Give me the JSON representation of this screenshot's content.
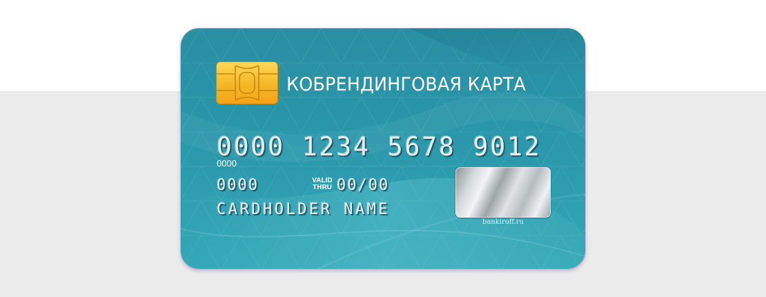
{
  "card": {
    "brand_title": "КОБРЕНДИНГОВАЯ КАРТА",
    "card_number": "0000 1234 5678 9012",
    "number_sub_code": "0000",
    "left_code": "0000",
    "valid_thru_label_line1": "VALID",
    "valid_thru_label_line2": "THRU",
    "expiry": "00/00",
    "cardholder_name": "CARDHOLDER NAME",
    "watermark": "bankiroff.ru"
  },
  "colors": {
    "card_base": "#2a97aa",
    "chip_gold": "#f2c53d",
    "page_top": "#ffffff",
    "page_bottom": "#ebebeb"
  },
  "icons": {
    "chip": "emv-chip-icon",
    "hologram": "hologram-sticker"
  }
}
